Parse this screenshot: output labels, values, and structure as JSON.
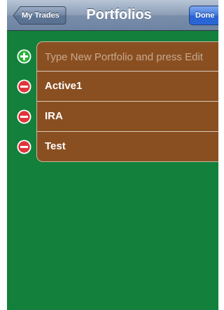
{
  "colors": {
    "nav_bar": "#8c9db5",
    "done_button": "#2a63d2",
    "background": "#13803c",
    "cell": "#8a4f21",
    "cell_separator": "#d9cbb8",
    "add_icon": "#2bb03a",
    "delete_icon": "#e0353b"
  },
  "navbar": {
    "back_label": "My Trades",
    "title": "Portfolios",
    "done_label": "Done"
  },
  "new_portfolio": {
    "placeholder": "Type New Portfolio and press Edit",
    "value": "",
    "icon": "add-icon"
  },
  "portfolios": [
    {
      "name": "Active1",
      "icon": "delete-icon"
    },
    {
      "name": "IRA",
      "icon": "delete-icon"
    },
    {
      "name": "Test",
      "icon": "delete-icon"
    }
  ]
}
